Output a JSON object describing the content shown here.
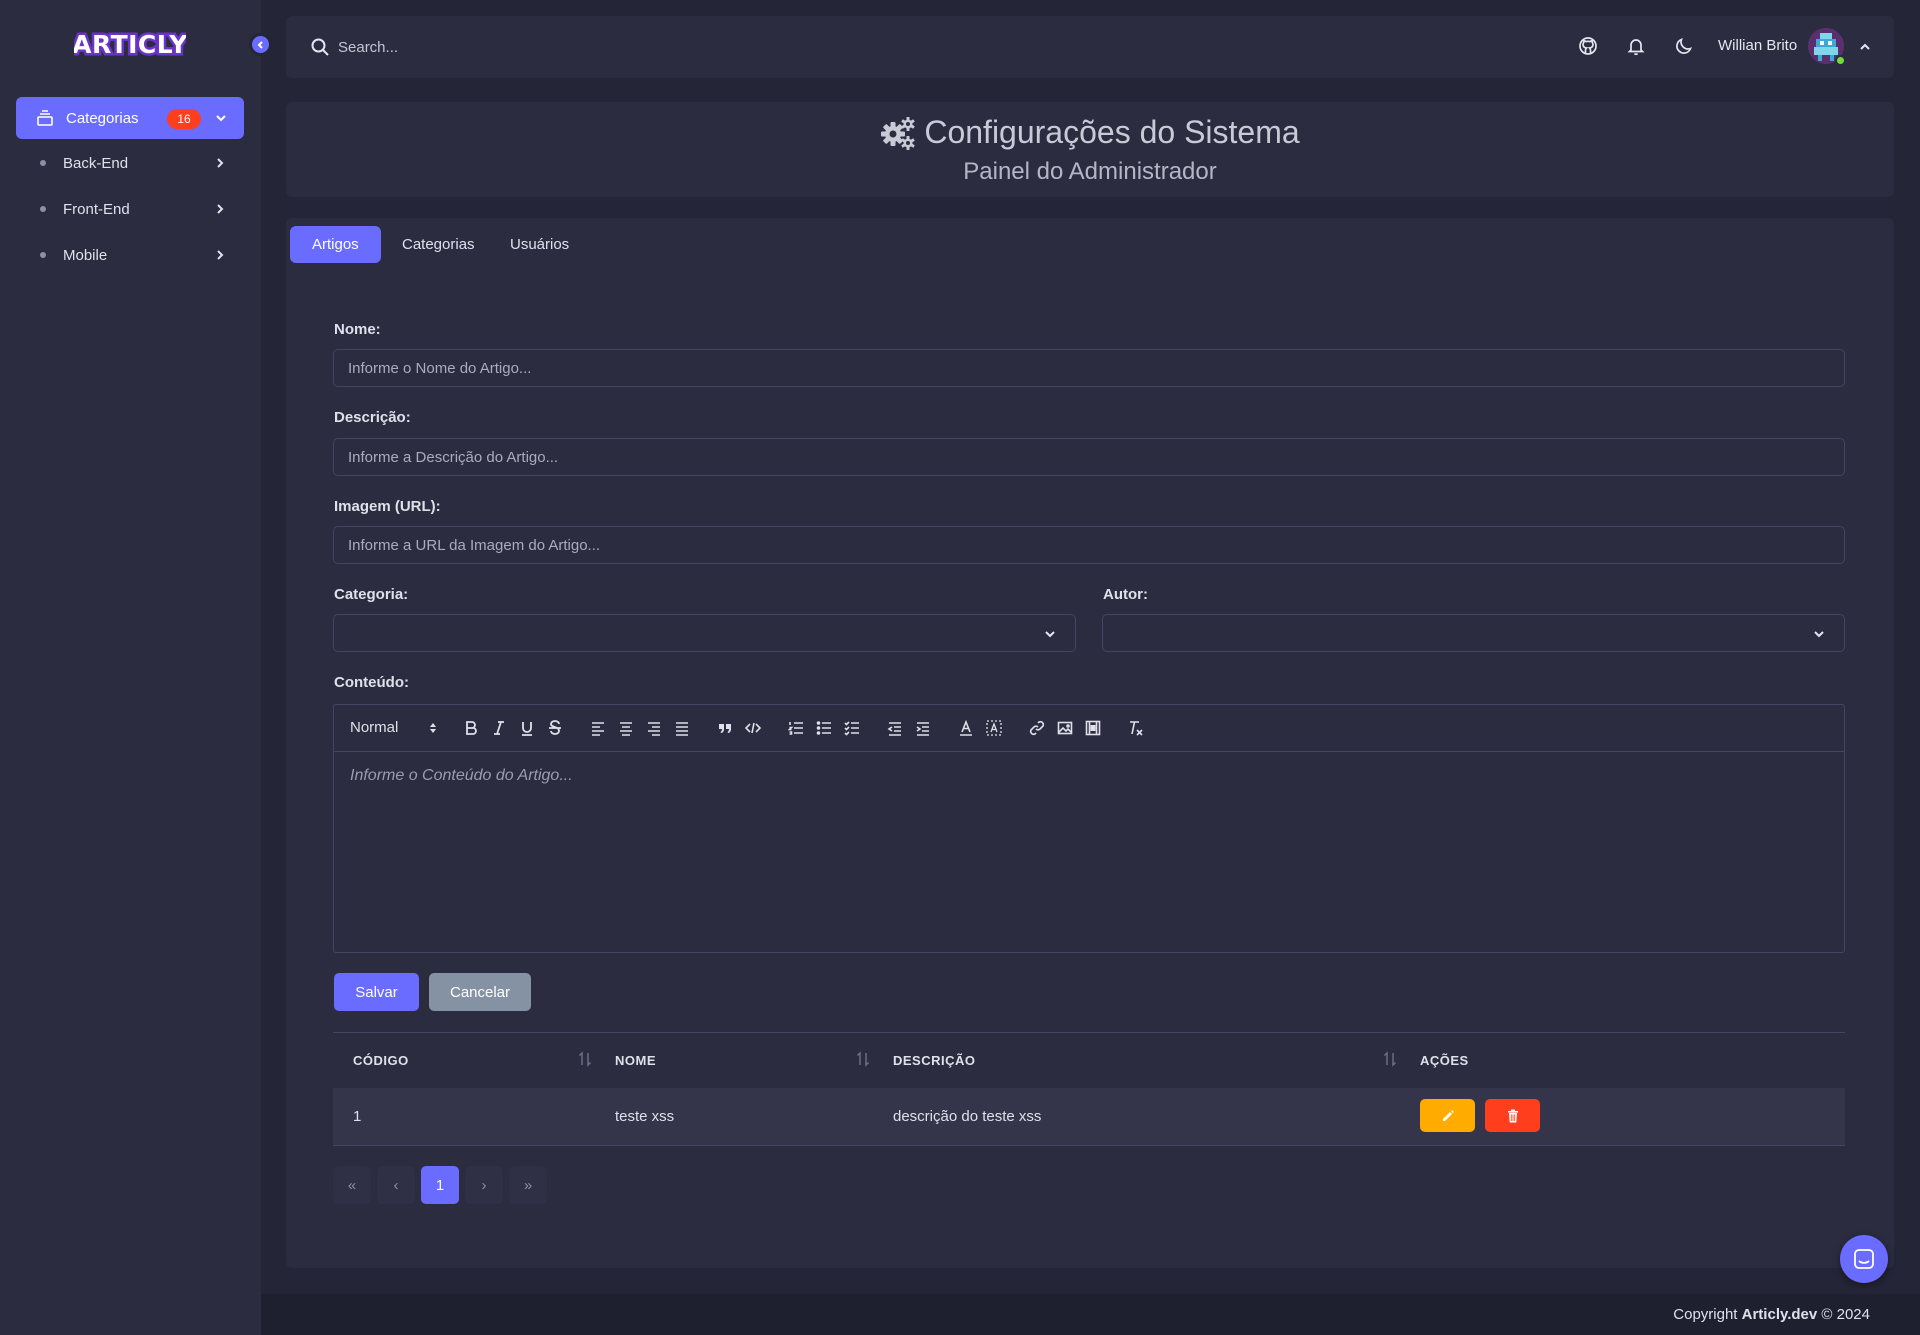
{
  "brand": {
    "logo_text": "ARTICLY"
  },
  "sidebar": {
    "menu": {
      "label": "Categorias",
      "badge": "16"
    },
    "items": [
      {
        "label": "Back-End"
      },
      {
        "label": "Front-End"
      },
      {
        "label": "Mobile"
      }
    ]
  },
  "navbar": {
    "search_placeholder": "Search...",
    "user_name": "Willian Brito"
  },
  "title_card": {
    "title": "Configurações do Sistema",
    "subtitle": "Painel do Administrador"
  },
  "tabs": [
    {
      "label": "Artigos",
      "active": true
    },
    {
      "label": "Categorias",
      "active": false
    },
    {
      "label": "Usuários",
      "active": false
    }
  ],
  "form": {
    "nome_label": "Nome:",
    "nome_placeholder": "Informe o Nome do Artigo...",
    "descricao_label": "Descrição:",
    "descricao_placeholder": "Informe a Descrição do Artigo...",
    "imagem_label": "Imagem (URL):",
    "imagem_placeholder": "Informe a URL da Imagem do Artigo...",
    "categoria_label": "Categoria:",
    "categoria_value": "",
    "autor_label": "Autor:",
    "autor_value": "",
    "conteudo_label": "Conteúdo:",
    "editor_format": "Normal",
    "editor_placeholder": "Informe o Conteúdo do Artigo...",
    "save_label": "Salvar",
    "cancel_label": "Cancelar"
  },
  "table": {
    "columns": [
      "CÓDIGO",
      "NOME",
      "DESCRIÇÃO",
      "AÇÕES"
    ],
    "rows": [
      {
        "codigo": "1",
        "nome": "teste xss",
        "descricao": "descrição do teste xss"
      }
    ]
  },
  "pagination": {
    "first": "«",
    "prev": "‹",
    "current": "1",
    "next": "›",
    "last": "»"
  },
  "footer": {
    "prefix": "Copyright ",
    "brand": "Articly.dev",
    "suffix": " © 2024"
  },
  "colors": {
    "primary": "#696cff",
    "danger": "#ff3e1d",
    "warning": "#ffab00",
    "secondary": "#8592a3",
    "success": "#71dd37"
  }
}
